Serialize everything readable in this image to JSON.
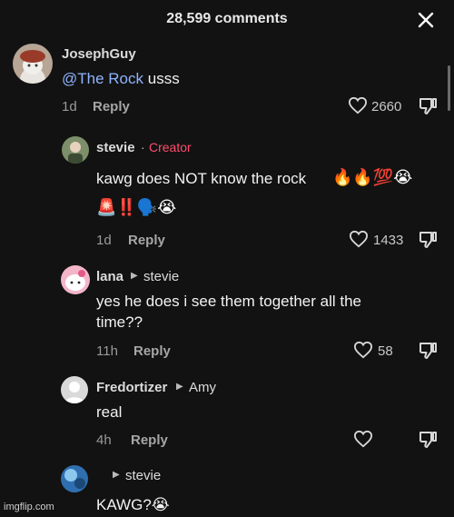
{
  "header": {
    "title": "28,599 comments"
  },
  "comments": [
    {
      "username": "JosephGuy",
      "mention": "@The Rock",
      "text": " usss",
      "time": "1d",
      "reply_label": "Reply",
      "likes": "2660"
    },
    {
      "username": "stevie",
      "separator": "·",
      "badge": "Creator",
      "text": "kawg does NOT know the rock",
      "emojis_line1": "🔥🔥💯😭",
      "emojis_line2": "🚨‼️🗣️😭",
      "time": "1d",
      "reply_label": "Reply",
      "likes": "1433"
    },
    {
      "username": "lana",
      "reply_to": "stevie",
      "text_line1": "yes he does i see them together all the",
      "text_line2": "time??",
      "time": "11h",
      "reply_label": "Reply",
      "likes": "58"
    },
    {
      "username": "Fredortizer",
      "reply_to": "Amy",
      "text": "real",
      "time": "4h",
      "reply_label": "Reply"
    },
    {
      "username": "",
      "reply_to": "stevie",
      "text": "KAWG?😭"
    }
  ],
  "watermark": "imgflip.com",
  "colors": {
    "background": "#121212",
    "creator": "#ff4d6d",
    "mention": "#8fb4ff"
  },
  "icons": [
    "close-icon",
    "heart-icon",
    "dislike-icon"
  ]
}
